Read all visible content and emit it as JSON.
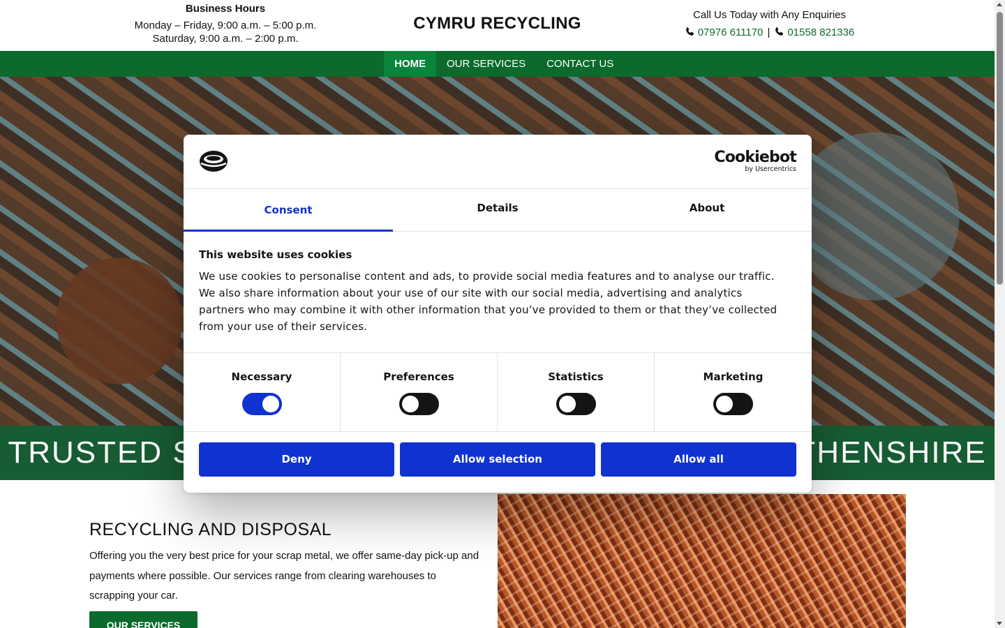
{
  "header": {
    "hours_title": "Business Hours",
    "hours_weekday": "Monday – Friday, 9:00 a.m. – 5:00 p.m.",
    "hours_saturday": "Saturday, 9:00 a.m. – 2:00 p.m.",
    "brand": "CYMRU RECYCLING",
    "contact_title": "Call Us Today with Any Enquiries",
    "phone_1": "07976 611170",
    "phone_separator": "|",
    "phone_2": "01558 821336"
  },
  "nav": {
    "items": [
      {
        "label": "HOME",
        "active": true
      },
      {
        "label": "OUR SERVICES",
        "active": false
      },
      {
        "label": "CONTACT US",
        "active": false
      }
    ]
  },
  "hero": {
    "banner_text": "TRUSTED SCRAP METAL RECYCLING IN CARMARTHENSHIRE",
    "banner_visible_left": "TRUSTED SC",
    "banner_visible_right": "RTHENSHIRE"
  },
  "services": {
    "heading": "RECYCLING AND DISPOSAL",
    "body": "Offering you the very best price for your scrap metal, we offer same-day pick-up and payments where possible. Our services range from clearing warehouses to scrapping your car.",
    "button_label": "OUR SERVICES"
  },
  "cookie_dialog": {
    "brand_name": "Cookiebot",
    "brand_sub": "by Usercentrics",
    "tabs": [
      {
        "label": "Consent",
        "active": true
      },
      {
        "label": "Details",
        "active": false
      },
      {
        "label": "About",
        "active": false
      }
    ],
    "title": "This website uses cookies",
    "body": "We use cookies to personalise content and ads, to provide social media features and to analyse our traffic. We also share information about your use of our site with our social media, advertising and analytics partners who may combine it with other information that you’ve provided to them or that they’ve collected from your use of their services.",
    "toggles": [
      {
        "label": "Necessary",
        "on": true
      },
      {
        "label": "Preferences",
        "on": false
      },
      {
        "label": "Statistics",
        "on": false
      },
      {
        "label": "Marketing",
        "on": false
      }
    ],
    "buttons": {
      "deny": "Deny",
      "allow_selection": "Allow selection",
      "allow_all": "Allow all"
    },
    "accent_color": "#1032cf"
  },
  "colors": {
    "brand_green": "#0b6a2c",
    "nav_active": "#08853a",
    "banner_green": "#175c33"
  }
}
